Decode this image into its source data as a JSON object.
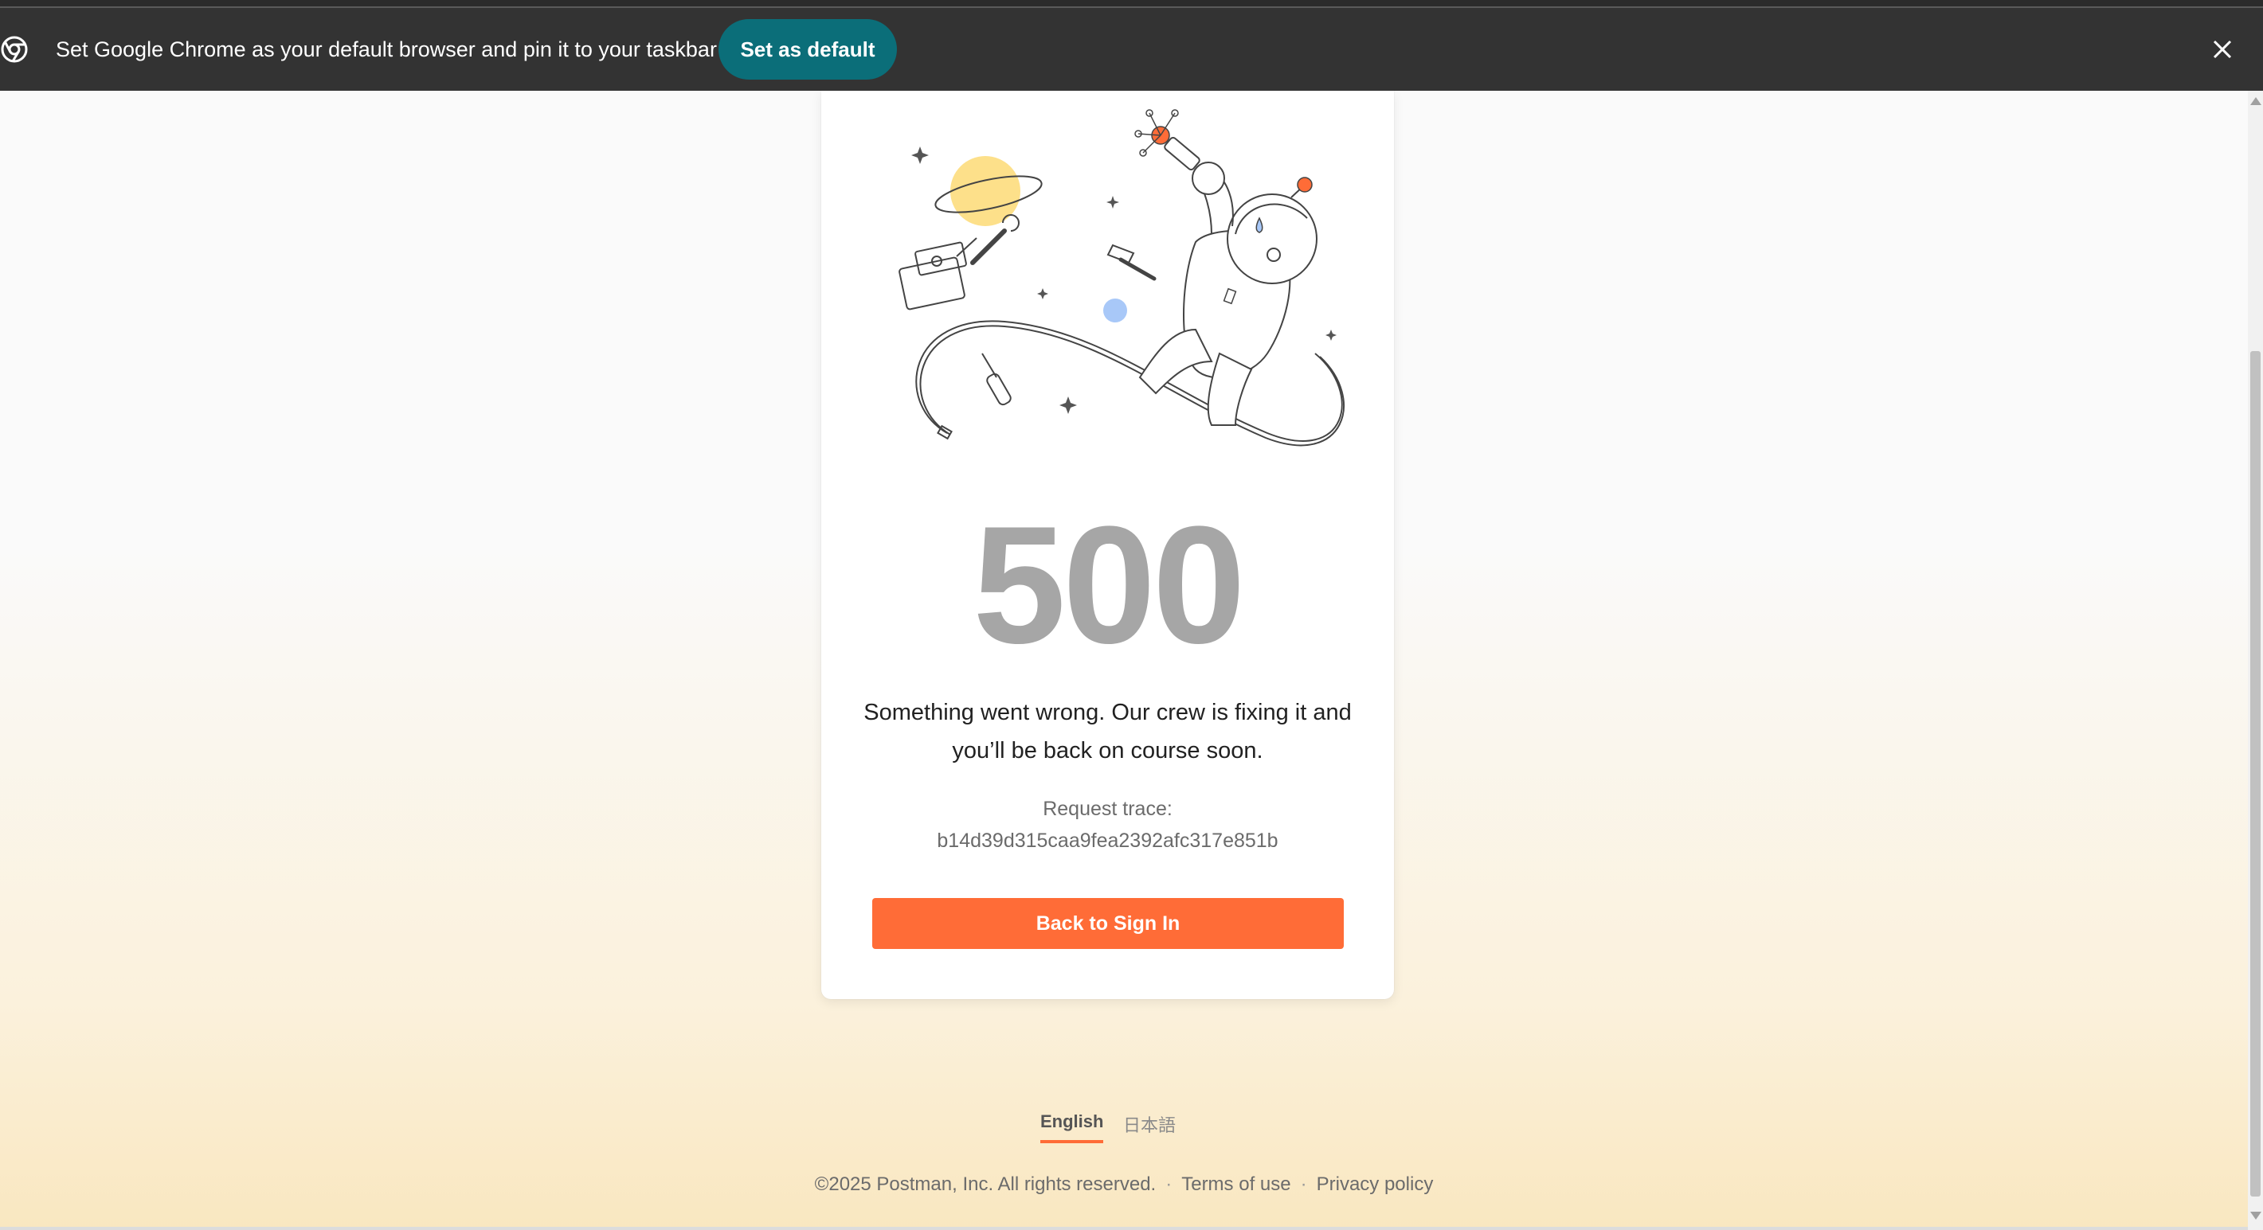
{
  "infobar": {
    "message": "Set Google Chrome as your default browser and pin it to your taskbar",
    "set_default_label": "Set as default",
    "close_icon": "close-icon",
    "chrome_icon": "chrome-logo-icon"
  },
  "error": {
    "code": "500",
    "message": "Something went wrong. Our crew is fixing it and you’ll be back on course soon.",
    "trace_label": "Request trace:",
    "trace_value": "b14d39d315caa9fea2392afc317e851b",
    "back_button_label": "Back to Sign In"
  },
  "languages": {
    "selected": "English",
    "other": "日本語"
  },
  "footer": {
    "copyright": "©2025 Postman, Inc. All rights reserved.",
    "separator": "·",
    "terms": "Terms of use",
    "privacy": "Privacy policy"
  },
  "colors": {
    "accent": "#ff6c37",
    "infobar_bg": "#333333",
    "set_default_bg": "#0b6e79",
    "code_gray": "#a6a6a6"
  }
}
